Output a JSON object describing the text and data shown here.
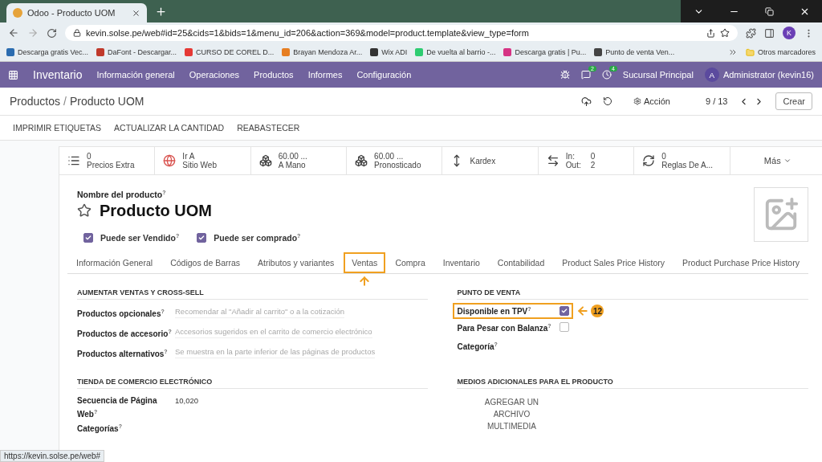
{
  "browser": {
    "tab_title": "Odoo - Producto UOM",
    "url": "kevin.solse.pe/web#id=25&cids=1&bids=1&menu_id=206&action=369&model=product.template&view_type=form",
    "avatar": "K",
    "bookmarks": [
      "Descarga gratis Vec...",
      "DaFont - Descargar...",
      "CURSO DE COREL D...",
      "Brayan Mendoza Ar...",
      "Wix ADI",
      "De vuelta al barrio -...",
      "Descarga gratis | Pu...",
      "Punto de venta Ven..."
    ],
    "other_bookmarks": "Otros marcadores",
    "status_url": "https://kevin.solse.pe/web#"
  },
  "navbar": {
    "app": "Inventario",
    "menus": [
      "Información general",
      "Operaciones",
      "Productos",
      "Informes",
      "Configuración"
    ],
    "messages_count": "2",
    "activities_count": "4",
    "company": "Sucursal Principal",
    "user_initial": "A",
    "user": "Administrator (kevin16)"
  },
  "control_panel": {
    "breadcrumb_parent": "Productos",
    "breadcrumb_separator": "/",
    "breadcrumb_current": "Producto UOM",
    "action": "Acción",
    "pager": "9 / 13",
    "create": "Crear"
  },
  "action_buttons": [
    "IMPRIMIR ETIQUETAS",
    "ACTUALIZAR LA CANTIDAD",
    "REABASTECER"
  ],
  "smart_buttons": [
    {
      "kind": "stat",
      "value": "0",
      "label": "Precios Extra"
    },
    {
      "kind": "stat",
      "value": "Ir A",
      "label": "Sitio Web"
    },
    {
      "kind": "stat",
      "value": "60.00 ...",
      "label": "A Mano"
    },
    {
      "kind": "stat",
      "value": "60.00 ...",
      "label": "Pronosticado"
    },
    {
      "kind": "single",
      "label": "Kardex"
    },
    {
      "kind": "inout",
      "rows": [
        {
          "label": "In:",
          "value": "0"
        },
        {
          "label": "Out:",
          "value": "2"
        }
      ]
    },
    {
      "kind": "stat",
      "value": "0",
      "label": "Reglas De A..."
    },
    {
      "kind": "more",
      "label": "Más"
    }
  ],
  "product": {
    "name_label": "Nombre del producto$^{?}$",
    "name": "Producto UOM",
    "favorite": false,
    "options": [
      {
        "label": "Puede ser Vendido$^{?}$",
        "checked": true
      },
      {
        "label": "Puede ser comprado$^{?}$",
        "checked": true
      }
    ]
  },
  "tabs": [
    {
      "label": "Información General",
      "selected": false
    },
    {
      "label": "Códigos de Barras",
      "selected": false
    },
    {
      "label": "Atributos y variantes",
      "selected": false
    },
    {
      "label": "Ventas",
      "selected": true
    },
    {
      "label": "Compra",
      "selected": false
    },
    {
      "label": "Inventario",
      "selected": false
    },
    {
      "label": "Contabilidad",
      "selected": false
    },
    {
      "label": "Product Sales Price History",
      "selected": false
    },
    {
      "label": "Product Purchase Price History",
      "selected": false
    }
  ],
  "sections": [
    {
      "title": "AUMENTAR VENTAS Y CROSS-SELL",
      "fields": [
        {
          "kind": "text",
          "label": "Productos opcionales$^{?}$",
          "placeholder": "Recomendar al \"Añadir al carrito\" o a la cotización"
        },
        {
          "kind": "text",
          "label": "Productos de accesorio$^{?}$",
          "placeholder": "Accesorios sugeridos en el carrito de comercio electrónico"
        },
        {
          "kind": "text",
          "label": "Productos alternativos$^{?}$",
          "placeholder": "Se muestra en la parte inferior de las páginas de productos"
        }
      ]
    },
    {
      "title": "PUNTO DE VENTA",
      "fields": [
        {
          "kind": "check",
          "label": "Disponible en TPV$^{?}$",
          "checked": true,
          "highlighted": true,
          "annotation": "12"
        },
        {
          "kind": "check",
          "label": "Para Pesar con Balanza$^{?}$",
          "checked": false,
          "highlighted": false
        },
        {
          "kind": "text",
          "label": "Categoría$^{?}$"
        }
      ]
    },
    {
      "title": "TIENDA DE COMERCIO ELECTRÓNICO",
      "fields": [
        {
          "kind": "text",
          "label": "Secuencia de Página Web$^{?}$",
          "value": "10,020"
        },
        {
          "kind": "text",
          "label": "Categorías$^{?}$"
        }
      ]
    },
    {
      "title": "MEDIOS ADICIONALES PARA EL PRODUCTO",
      "fields": [
        {
          "kind": "upload",
          "label": "AGREGAR UN ARCHIVO MULTIMEDIA"
        }
      ]
    }
  ]
}
